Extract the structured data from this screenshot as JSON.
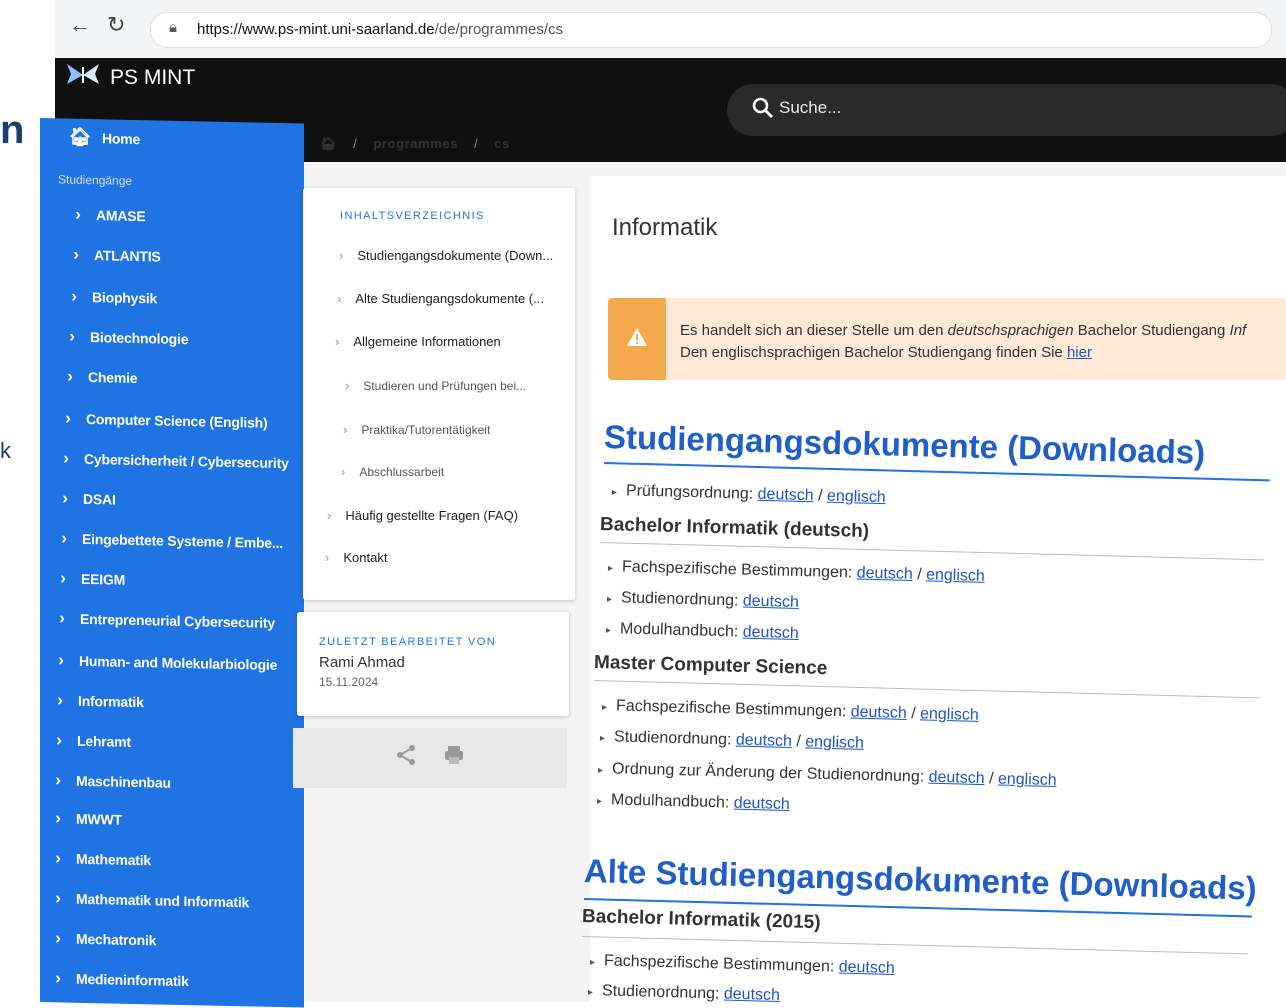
{
  "edge": {
    "partial_n": "n",
    "partial_k": "k"
  },
  "browser": {
    "url_domain": "https://www.ps-mint.uni-saarland.de",
    "url_path": "/de/programmes/cs"
  },
  "appbar": {
    "brand": "PS MINT",
    "search_placeholder": "Suche..."
  },
  "sidebar": {
    "home": "Home",
    "category": "Studiengänge",
    "items": [
      "AMASE",
      "ATLANTIS",
      "Biophysik",
      "Biotechnologie",
      "Chemie",
      "Computer Science (English)",
      "Cybersicherheit / Cybersecurity",
      "DSAI",
      "Eingebettete Systeme / Embe...",
      "EEIGM",
      "Entrepreneurial Cybersecurity",
      "Human- and Molekularbiologie",
      "Informatik",
      "Lehramt",
      "Maschinenbau",
      "MWWT",
      "Mathematik",
      "Mathematik und Informatik",
      "Mechatronik",
      "Medieninformatik"
    ]
  },
  "breadcrumb": {
    "a": "programmes",
    "b": "cs",
    "sep": "/"
  },
  "toc": {
    "title": "INHALTSVERZEICHNIS",
    "items": [
      "Studiengangsdokumente (Down...",
      "Alte Studiengangsdokumente (...",
      "Allgemeine Informationen",
      "Studieren und Prüfungen bei...",
      "Praktika/Tutorentätigkeit",
      "Abschlussarbeit",
      "Häufig gestellte Fragen (FAQ)",
      "Kontakt"
    ]
  },
  "edited": {
    "label": "ZULETZT BEARBEITET VON",
    "name": "Rami Ahmad",
    "date": "15.11.2024"
  },
  "main": {
    "title": "Informatik",
    "alert": {
      "l1_a": "Es handelt sich an dieser Stelle um den ",
      "l1_b": "deutschsprachigen",
      "l1_c": " Bachelor Studiengang ",
      "l1_d": "Inf",
      "l2_a": "Den englischsprachigen Bachelor Studiengang finden Sie ",
      "l2_link": "hier"
    },
    "h1_docs": "Studiengangsdokumente (Downloads)",
    "po_label": "Prüfungsordnung: ",
    "deutsch": "deutsch",
    "englisch": "englisch",
    "slash": " / ",
    "bachelor_heading": "Bachelor Informatik (deutsch)",
    "fach": "Fachspezifische Bestimmungen: ",
    "studien": "Studienordnung: ",
    "modul": "Modulhandbuch: ",
    "aenderung": "Ordnung zur Änderung der Studienordnung: ",
    "master_heading": "Master Computer Science",
    "h1_old": "Alte Studiengangsdokumente (Downloads)",
    "old_bachelor_heading": "Bachelor Informatik (2015)"
  }
}
